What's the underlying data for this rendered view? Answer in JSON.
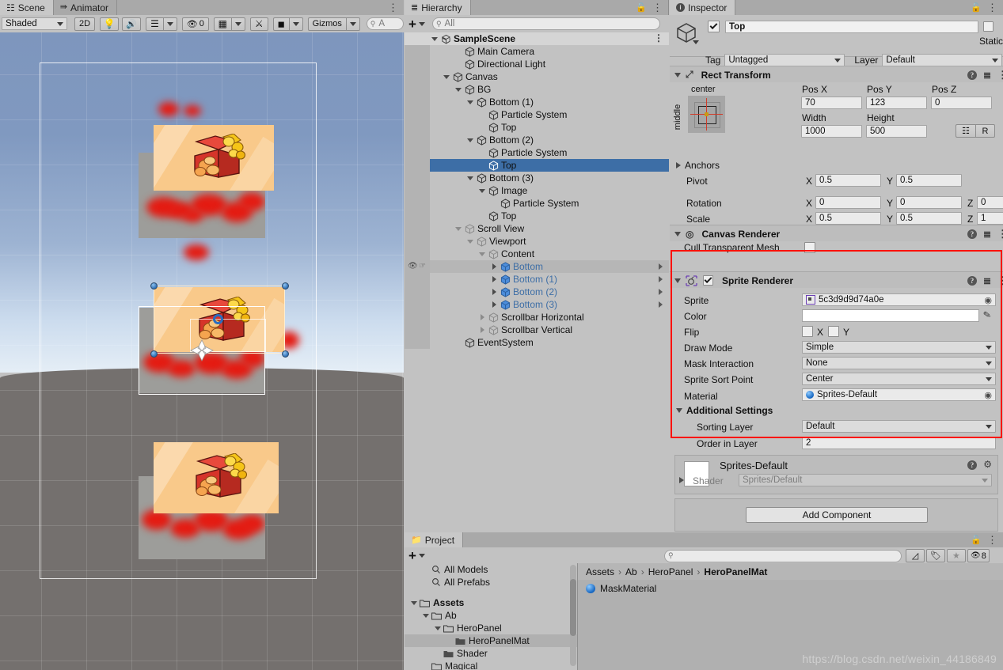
{
  "scene_view": {
    "tabs": [
      {
        "label": "Scene",
        "icon": "grid-icon",
        "active": true
      },
      {
        "label": "Animator",
        "icon": "animator-icon",
        "active": false
      }
    ],
    "toolbar": {
      "shading_mode": "Shaded",
      "mode_2d": "2D",
      "lighting_icon": "lightbulb-icon",
      "audio_icon": "speaker-icon",
      "fx_icon": "effects-icon",
      "hidden_count": "0",
      "grid_icon": "grid-visibility-icon",
      "tools_icon": "scene-tools-icon",
      "camera_icon": "camera-icon",
      "gizmos_label": "Gizmos",
      "search_placeholder": "A"
    }
  },
  "hierarchy": {
    "title": "Hierarchy",
    "create_label": "+",
    "search_placeholder": "All",
    "rows": [
      {
        "label": "SampleScene",
        "depth": 0,
        "icon": "unity-scene-icon",
        "expanded": true,
        "type": "scene"
      },
      {
        "label": "Main Camera",
        "depth": 2,
        "icon": "gameobject-icon",
        "type": "object"
      },
      {
        "label": "Directional Light",
        "depth": 2,
        "icon": "gameobject-icon",
        "type": "object"
      },
      {
        "label": "Canvas",
        "depth": 1,
        "icon": "gameobject-icon",
        "expanded": true,
        "type": "object"
      },
      {
        "label": "BG",
        "depth": 2,
        "icon": "gameobject-icon",
        "expanded": true,
        "type": "object"
      },
      {
        "label": "Bottom (1)",
        "depth": 3,
        "icon": "gameobject-icon",
        "expanded": true,
        "type": "object"
      },
      {
        "label": "Particle System",
        "depth": 4,
        "icon": "gameobject-icon",
        "type": "object"
      },
      {
        "label": "Top",
        "depth": 4,
        "icon": "gameobject-icon",
        "type": "object"
      },
      {
        "label": "Bottom (2)",
        "depth": 3,
        "icon": "gameobject-icon",
        "expanded": true,
        "type": "object"
      },
      {
        "label": "Particle System",
        "depth": 4,
        "icon": "gameobject-icon",
        "type": "object"
      },
      {
        "label": "Top",
        "depth": 4,
        "icon": "gameobject-icon",
        "type": "object",
        "selected": true
      },
      {
        "label": "Bottom (3)",
        "depth": 3,
        "icon": "gameobject-icon",
        "expanded": true,
        "type": "object"
      },
      {
        "label": "Image",
        "depth": 4,
        "icon": "gameobject-icon",
        "expanded": true,
        "type": "object"
      },
      {
        "label": "Particle System",
        "depth": 5,
        "icon": "gameobject-icon",
        "type": "object"
      },
      {
        "label": "Top",
        "depth": 4,
        "icon": "gameobject-icon",
        "type": "object"
      },
      {
        "label": "Scroll View",
        "depth": 2,
        "icon": "gameobject-icon",
        "expanded": true,
        "type": "object",
        "dim": true
      },
      {
        "label": "Viewport",
        "depth": 3,
        "icon": "gameobject-icon",
        "expanded": true,
        "type": "object",
        "dim": true
      },
      {
        "label": "Content",
        "depth": 4,
        "icon": "gameobject-icon",
        "expanded": true,
        "type": "object",
        "dim": true
      },
      {
        "label": "Bottom",
        "depth": 5,
        "icon": "prefab-icon",
        "collapsed": true,
        "type": "prefab",
        "hovered": true,
        "prefab": true,
        "has_arrow": true
      },
      {
        "label": "Bottom (1)",
        "depth": 5,
        "icon": "prefab-icon",
        "collapsed": true,
        "type": "prefab",
        "prefab": true,
        "has_arrow": true
      },
      {
        "label": "Bottom (2)",
        "depth": 5,
        "icon": "prefab-icon",
        "collapsed": true,
        "type": "prefab",
        "prefab": true,
        "has_arrow": true
      },
      {
        "label": "Bottom (3)",
        "depth": 5,
        "icon": "prefab-icon",
        "collapsed": true,
        "type": "prefab",
        "prefab": true,
        "has_arrow": true
      },
      {
        "label": "Scrollbar Horizontal",
        "depth": 4,
        "icon": "gameobject-icon",
        "collapsed": true,
        "type": "object",
        "dim": true
      },
      {
        "label": "Scrollbar Vertical",
        "depth": 4,
        "icon": "gameobject-icon",
        "collapsed": true,
        "type": "object",
        "dim": true
      },
      {
        "label": "EventSystem",
        "depth": 2,
        "icon": "gameobject-icon",
        "type": "object"
      }
    ]
  },
  "inspector": {
    "title": "Inspector",
    "object": {
      "enabled": true,
      "name": "Top",
      "static_label": "Static",
      "static_checked": false,
      "tag_label": "Tag",
      "tag_value": "Untagged",
      "layer_label": "Layer",
      "layer_value": "Default"
    },
    "rect_transform": {
      "title": "Rect Transform",
      "anchor_preset_top": "center",
      "anchor_preset_side": "middle",
      "pos_x_label": "Pos X",
      "pos_x": "70",
      "pos_y_label": "Pos Y",
      "pos_y": "123",
      "pos_z_label": "Pos Z",
      "pos_z": "0",
      "width_label": "Width",
      "width": "1000",
      "height_label": "Height",
      "height": "500",
      "blueprint_btn": "blueprint-mode-icon",
      "raw_btn": "R",
      "anchors_label": "Anchors",
      "pivot_label": "Pivot",
      "pivot_x": "0.5",
      "pivot_y": "0.5",
      "rotation_label": "Rotation",
      "rot_x": "0",
      "rot_y": "0",
      "rot_z": "0",
      "scale_label": "Scale",
      "scale_x": "0.5",
      "scale_y": "0.5",
      "scale_z": "1"
    },
    "canvas_renderer": {
      "title": "Canvas Renderer",
      "cull_label": "Cull Transparent Mesh",
      "cull_checked": false
    },
    "sprite_renderer": {
      "title": "Sprite Renderer",
      "enabled": true,
      "highlighted": true,
      "sprite_label": "Sprite",
      "sprite_value": "5c3d9d9d74a0e",
      "color_label": "Color",
      "color_value": "#FFFFFF",
      "flip_label": "Flip",
      "flip_x_label": "X",
      "flip_x": false,
      "flip_y_label": "Y",
      "flip_y": false,
      "draw_mode_label": "Draw Mode",
      "draw_mode": "Simple",
      "mask_interaction_label": "Mask Interaction",
      "mask_interaction": "None",
      "sprite_sort_point_label": "Sprite Sort Point",
      "sprite_sort_point": "Center",
      "material_label": "Material",
      "material": "Sprites-Default",
      "additional_settings_label": "Additional Settings",
      "sorting_layer_label": "Sorting Layer",
      "sorting_layer": "Default",
      "order_in_layer_label": "Order in Layer",
      "order_in_layer": "2"
    },
    "material_preview": {
      "title": "Sprites-Default",
      "shader_label": "Shader",
      "shader_value": "Sprites/Default"
    },
    "add_component_label": "Add Component"
  },
  "project": {
    "title": "Project",
    "create_label": "+",
    "search_placeholder": "",
    "tree": [
      {
        "label": "All Models",
        "depth": 1,
        "icon": "search-icon",
        "type": "filter"
      },
      {
        "label": "All Prefabs",
        "depth": 1,
        "icon": "search-icon",
        "type": "filter"
      },
      {
        "label": "",
        "depth": 0,
        "type": "spacer"
      },
      {
        "label": "Assets",
        "depth": 0,
        "icon": "folder-icon",
        "expanded": true,
        "bold": true
      },
      {
        "label": "Ab",
        "depth": 1,
        "icon": "folder-icon",
        "expanded": true
      },
      {
        "label": "HeroPanel",
        "depth": 2,
        "icon": "folder-icon",
        "expanded": true
      },
      {
        "label": "HeroPanelMat",
        "depth": 3,
        "icon": "folder-closed-icon",
        "selected": true
      },
      {
        "label": "Shader",
        "depth": 2,
        "icon": "folder-closed-icon"
      },
      {
        "label": "Magical",
        "depth": 1,
        "icon": "folder-icon",
        "clipped": true
      }
    ],
    "breadcrumb": [
      "Assets",
      "Ab",
      "HeroPanel",
      "HeroPanelMat"
    ],
    "items": [
      {
        "label": "MaskMaterial",
        "icon": "material-icon"
      }
    ],
    "toolbar_icons": [
      "search-by-type-icon",
      "label-icon",
      "favorite-star-icon"
    ],
    "hidden_count": "8",
    "watermark": "https://blog.csdn.net/weixin_44186849"
  },
  "colors": {
    "selection_blue": "#3d6ea6",
    "highlight_red": "#ff1000",
    "panel_bg": "#c2c2c2",
    "field_bg": "#eaeaea"
  }
}
